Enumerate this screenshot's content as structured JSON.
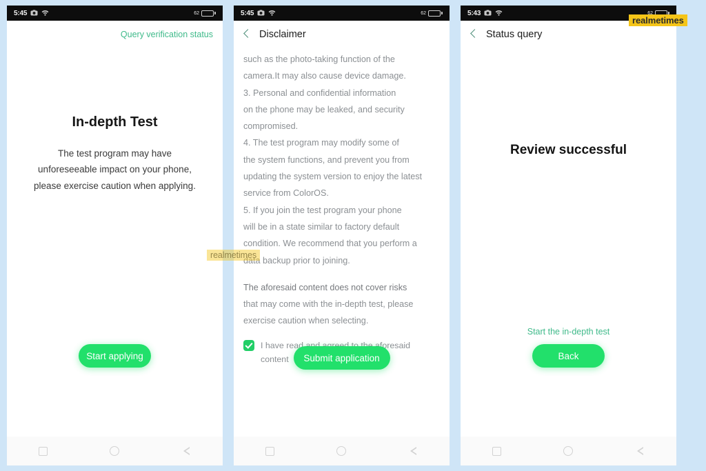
{
  "background_color": "#cfe5f7",
  "accent_green": "#22e06b",
  "link_green": "#3fba8a",
  "watermarks": [
    {
      "text": "realmetimes",
      "position": "center-overlay"
    },
    {
      "text": "realmetimes",
      "position": "top-right"
    }
  ],
  "navbar": {
    "recents_label": "recents-square",
    "home_label": "home-circle",
    "back_label": "back-triangle"
  },
  "screens": [
    {
      "id": "in-depth-test",
      "statusbar": {
        "time": "5:45",
        "icons": [
          "camera-icon",
          "wifi-icon"
        ],
        "battery_level": "62"
      },
      "top_link": "Query verification status",
      "title": "In-depth Test",
      "subtitle": "The test program may have unforeseeable impact on your phone, please exercise caution when applying.",
      "subtitle_lines": [
        "The test program may have",
        "unforeseeable impact on your phone,",
        "please exercise caution when applying."
      ],
      "primary_button": "Start applying"
    },
    {
      "id": "disclaimer",
      "statusbar": {
        "time": "5:45",
        "icons": [
          "camera-icon",
          "wifi-icon"
        ],
        "battery_level": "62"
      },
      "appbar_title": "Disclaimer",
      "body_lines": [
        "such as the photo-taking function of the",
        "camera.It may also cause device damage.",
        "3. Personal and confidential information",
        "on the phone may be leaked, and security",
        "compromised.",
        "4. The test program may modify some of",
        "the system functions, and prevent you from",
        "updating the system version to enjoy the latest",
        "service from ColorOS.",
        "5. If you join the test program your phone",
        "will be in a state similar to factory default",
        "condition. We recommend that you perform a",
        "data backup prior to joining."
      ],
      "closing_lines": [
        "The aforesaid content does not cover risks",
        "that may come with the in-depth test, please",
        "exercise caution when selecting."
      ],
      "agree_checked": true,
      "agree_text": "I have read and agreed to the aforesaid content",
      "primary_button": "Submit application"
    },
    {
      "id": "status-query",
      "statusbar": {
        "time": "5:43",
        "icons": [
          "camera-icon",
          "wifi-icon"
        ],
        "battery_level": "62"
      },
      "appbar_title": "Status query",
      "title": "Review successful",
      "link": "Start the in-depth test",
      "primary_button": "Back"
    }
  ]
}
